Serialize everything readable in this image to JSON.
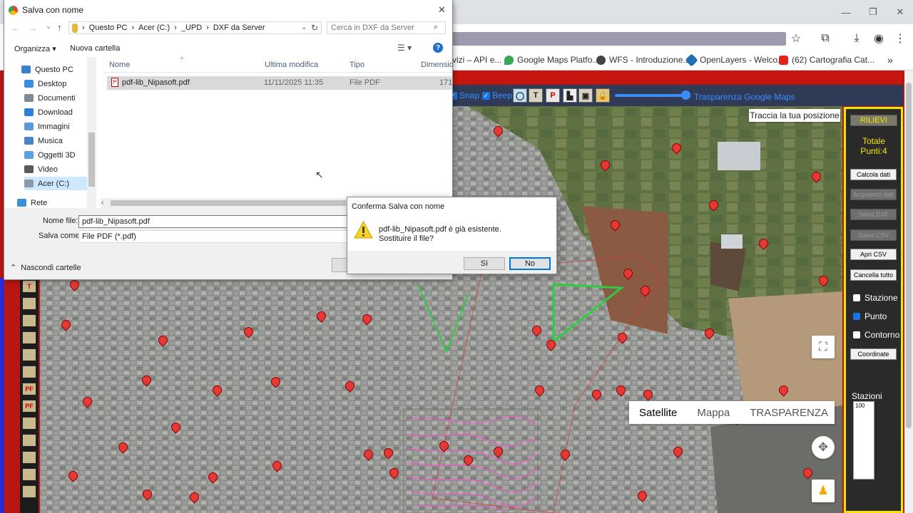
{
  "browser": {
    "bookmarks": [
      {
        "label": "vizi – API e...",
        "icon": "folder-icon"
      },
      {
        "label": "Google Maps Platfo...",
        "icon": "maps-pin-icon"
      },
      {
        "label": "WFS - Introduzione...",
        "icon": "globe-icon"
      },
      {
        "label": "OpenLayers - Welco...",
        "icon": "openlayers-icon"
      },
      {
        "label": "(62) Cartografia Cat...",
        "icon": "youtube-icon"
      }
    ]
  },
  "app": {
    "controls": {
      "snap_label": "Snap",
      "beep_label": "Beep",
      "transparency_label": "Trasparenza Google Maps"
    },
    "map": {
      "locate_button": "Traccia la tua posizione",
      "map_types": [
        "Satellite",
        "Mappa",
        "TRASPARENZA"
      ],
      "selected_map_type": "Satellite"
    },
    "panel": {
      "header": "RILIEVI",
      "totale_label": "Totale",
      "points_label": "Punti:4",
      "buttons": [
        {
          "label": "Calcola dati",
          "enabled": true
        },
        {
          "label": "Acquisisci dati",
          "enabled": false
        },
        {
          "label": "Salva DXF",
          "enabled": false
        },
        {
          "label": "Salva CSV",
          "enabled": false
        },
        {
          "label": "Apri CSV",
          "enabled": true
        },
        {
          "label": "Cancella tutto",
          "enabled": true
        }
      ],
      "checkboxes": [
        {
          "label": "Stazione",
          "checked": false
        },
        {
          "label": "Punto",
          "checked": true
        },
        {
          "label": "Contorno",
          "checked": false
        }
      ],
      "coordinate_button": "Coordinate",
      "stations_label": "Stazioni",
      "stations_value": "100"
    },
    "left_tools": [
      "T",
      "",
      "",
      "",
      "",
      "",
      "PF",
      "PF",
      "",
      "",
      "",
      "",
      ""
    ]
  },
  "save_dialog": {
    "title": "Salva con nome",
    "breadcrumb": [
      "Questo PC",
      "Acer (C:)",
      "_UPD",
      "DXF da Server"
    ],
    "search_placeholder": "Cerca in DXF da Server",
    "organize_label": "Organizza",
    "new_folder_label": "Nuova cartella",
    "nav_items": [
      {
        "label": "Questo PC",
        "icon": "computer-icon",
        "color": "#3b7fd1"
      },
      {
        "label": "Desktop",
        "icon": "desktop-icon",
        "color": "#3a8de0"
      },
      {
        "label": "Documenti",
        "icon": "documents-icon",
        "color": "#7f8a99"
      },
      {
        "label": "Download",
        "icon": "download-icon",
        "color": "#2d7fd8"
      },
      {
        "label": "Immagini",
        "icon": "pictures-icon",
        "color": "#5b9bd5"
      },
      {
        "label": "Musica",
        "icon": "music-icon",
        "color": "#4a86c7"
      },
      {
        "label": "Oggetti 3D",
        "icon": "3d-objects-icon",
        "color": "#5aa0e0"
      },
      {
        "label": "Video",
        "icon": "video-icon",
        "color": "#5a5a5a"
      },
      {
        "label": "Acer (C:)",
        "icon": "drive-icon",
        "color": "#8a9aa8"
      }
    ],
    "network_label": "Rete",
    "columns": [
      "Nome",
      "Ultima modifica",
      "Tipo",
      "Dimensio"
    ],
    "file": {
      "name": "pdf-lib_Nipasoft.pdf",
      "modified": "11/11/2025 11:35",
      "type": "File PDF",
      "size": "171"
    },
    "filename_label": "Nome file:",
    "filename_value": "pdf-lib_Nipasoft.pdf",
    "savetype_label": "Salva come:",
    "savetype_value": "File PDF (*.pdf)",
    "hide_folders_label": "Nascondi cartelle"
  },
  "confirm_dialog": {
    "title": "Conferma Salva con nome",
    "message_line1": "pdf-lib_Nipasoft.pdf è già esistente.",
    "message_line2": "Sostituire il file?",
    "yes_label": "Sì",
    "no_label": "No"
  },
  "colors": {
    "panel_border": "#f5e400",
    "page_red": "#ba1512",
    "accent_blue": "#3a8cff",
    "marker_red": "#e53935"
  }
}
